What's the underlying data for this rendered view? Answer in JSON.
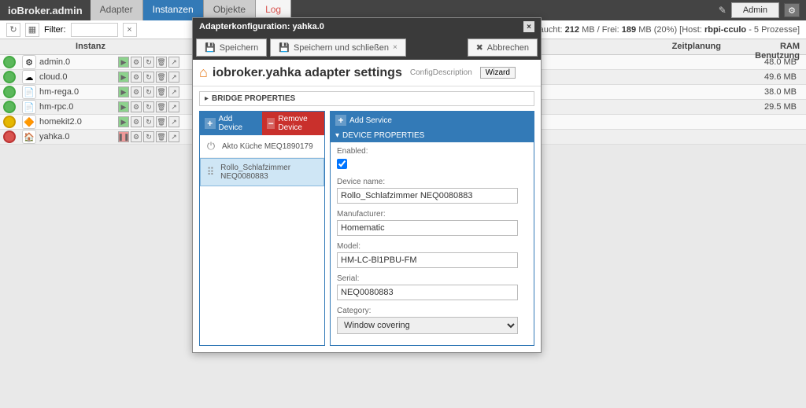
{
  "topbar": {
    "brand": "ioBroker.admin",
    "tabs": [
      "Adapter",
      "Instanzen",
      "Objekte",
      "Log"
    ],
    "active_tab": "Instanzen",
    "admin_label": "Admin"
  },
  "subbar": {
    "filter_label": "Filter:",
    "filter_value": "",
    "status_prefix": "gesamt RAM verbraucht: ",
    "ram_used": "212",
    "ram_mid": " MB / Frei: ",
    "ram_free": "189",
    "ram_pct": " MB (20%) ",
    "host_prefix": "[Host: ",
    "host": "rbpi-cculo",
    "host_suffix": " - 5 Prozesse]"
  },
  "columns": {
    "instanz": "Instanz",
    "zeit": "Zeitplanung",
    "ram": "RAM Benutzung"
  },
  "instances": [
    {
      "state": "green",
      "icon": "⚙",
      "name": "admin.0",
      "on": true,
      "ram": "48.0 MB"
    },
    {
      "state": "green",
      "icon": "☁",
      "name": "cloud.0",
      "on": true,
      "ram": "49.6 MB"
    },
    {
      "state": "green",
      "icon": "📄",
      "name": "hm-rega.0",
      "on": true,
      "ram": "38.0 MB"
    },
    {
      "state": "green",
      "icon": "📄",
      "name": "hm-rpc.0",
      "on": true,
      "ram": "29.5 MB"
    },
    {
      "state": "yellow",
      "icon": "🔶",
      "name": "homekit2.0",
      "on": true,
      "ram": ""
    },
    {
      "state": "red",
      "icon": "🏠",
      "name": "yahka.0",
      "on": false,
      "ram": ""
    }
  ],
  "dialog": {
    "title": "Adapterkonfiguration: yahka.0",
    "save": "Speichern",
    "save_close": "Speichern und schließen",
    "cancel": "Abbrechen",
    "heading": "iobroker.yahka adapter settings",
    "cfgdesc": "ConfigDescription",
    "wizard": "Wizard",
    "bridge": "BRIDGE PROPERTIES",
    "add_device": "Add Device",
    "remove_device": "Remove Device",
    "add_service": "Add Service",
    "devices": [
      {
        "icon": "⏻",
        "label": "Akto Küche MEQ1890179"
      },
      {
        "icon": "⠿",
        "label": "Rollo_Schlafzimmer NEQ0080883"
      }
    ],
    "selected_device": 1,
    "device_properties": "DEVICE PROPERTIES",
    "props": {
      "enabled_label": "Enabled:",
      "enabled": true,
      "devicename_label": "Device name:",
      "devicename": "Rollo_Schlafzimmer NEQ0080883",
      "manufacturer_label": "Manufacturer:",
      "manufacturer": "Homematic",
      "model_label": "Model:",
      "model": "HM-LC-Bl1PBU-FM",
      "serial_label": "Serial:",
      "serial": "NEQ0080883",
      "category_label": "Category:",
      "category": "Window covering"
    }
  }
}
